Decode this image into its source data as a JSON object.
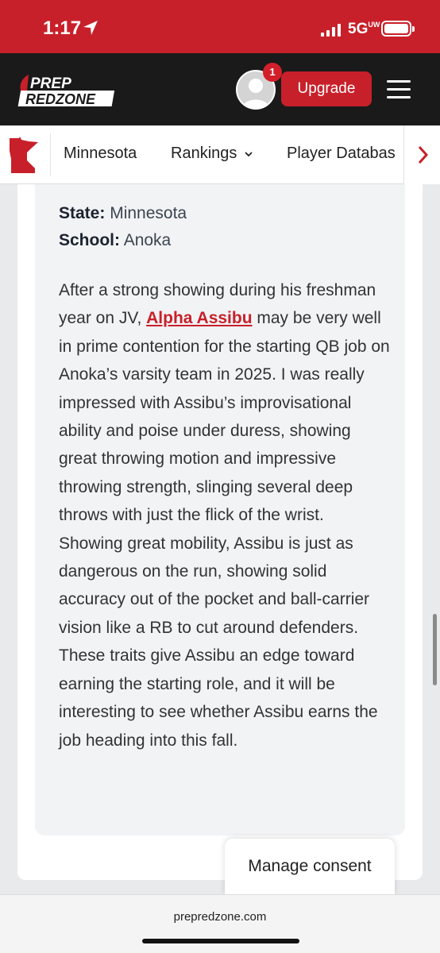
{
  "status": {
    "time": "1:17",
    "network": "5G",
    "network_sub": "UW"
  },
  "header": {
    "logo_top": "PREP",
    "logo_bottom": "REDZONE",
    "notification_count": "1",
    "upgrade_label": "Upgrade"
  },
  "nav": {
    "items": [
      {
        "label": "Minnesota"
      },
      {
        "label": "Rankings"
      },
      {
        "label": "Player Databas"
      }
    ]
  },
  "profile": {
    "state_label": "State:",
    "state_value": "Minnesota",
    "school_label": "School:",
    "school_value": "Anoka"
  },
  "article": {
    "before_link": "After a strong showing during his freshman year on JV, ",
    "link_text": "Alpha Assibu",
    "after_link": " may be very well in prime contention for the starting QB job on Anoka’s varsity team in 2025. I was really impressed with Assibu’s improvisational ability and poise under duress, showing great throwing motion and impressive throwing strength, slinging several deep throws with just the flick of the wrist. Showing great mobility, Assibu is just as dangerous on the run, showing solid accuracy out of the pocket and ball-carrier vision like a RB to cut around defenders. These traits give Assibu an edge toward earning the starting role, and it will be interesting to see whether Assibu earns the job heading into this fall."
  },
  "consent": {
    "label": "Manage consent"
  },
  "browser": {
    "url": "prepredzone.com"
  },
  "colors": {
    "brand_red": "#c8202a",
    "header_dark": "#1a1a1a"
  }
}
